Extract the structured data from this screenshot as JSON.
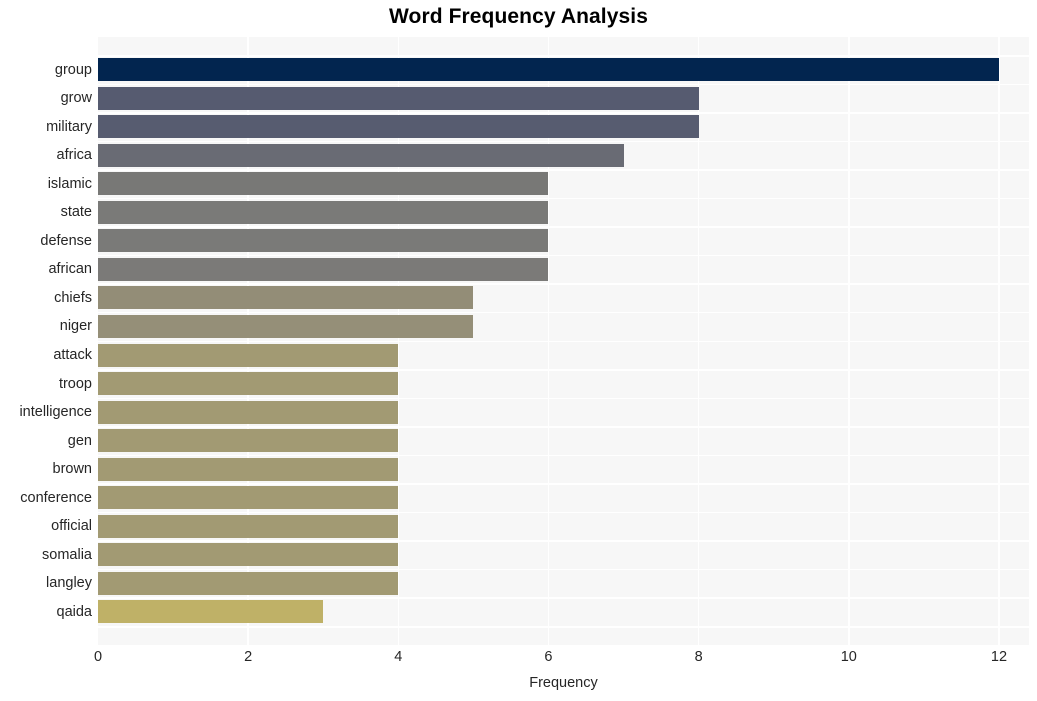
{
  "chart_data": {
    "type": "bar",
    "orientation": "horizontal",
    "title": "Word Frequency Analysis",
    "xlabel": "Frequency",
    "ylabel": "",
    "categories": [
      "group",
      "grow",
      "military",
      "africa",
      "islamic",
      "state",
      "defense",
      "african",
      "chiefs",
      "niger",
      "attack",
      "troop",
      "intelligence",
      "gen",
      "brown",
      "conference",
      "official",
      "somalia",
      "langley",
      "qaida"
    ],
    "values": [
      12,
      8,
      8,
      7,
      6,
      6,
      6,
      6,
      5,
      5,
      4,
      4,
      4,
      4,
      4,
      4,
      4,
      4,
      4,
      3
    ],
    "bar_colors": [
      "#02254f",
      "#565b70",
      "#575c70",
      "#696b74",
      "#787876",
      "#7a7a78",
      "#7a7a78",
      "#7b7a78",
      "#938d77",
      "#958f78",
      "#a29a73",
      "#a29a73",
      "#a29a73",
      "#a29a73",
      "#a29a73",
      "#a29a73",
      "#a29a73",
      "#a29a73",
      "#a29a73",
      "#bfb167"
    ],
    "xlim": [
      0,
      12.4
    ],
    "xticks": [
      0,
      2,
      4,
      6,
      8,
      10,
      12
    ],
    "xtick_labels": [
      "0",
      "2",
      "4",
      "6",
      "8",
      "10",
      "12"
    ],
    "grid": true,
    "grid_color": "#ffffff",
    "plot_background": "#f7f7f7",
    "figure_background": "#ffffff",
    "legend": null
  }
}
